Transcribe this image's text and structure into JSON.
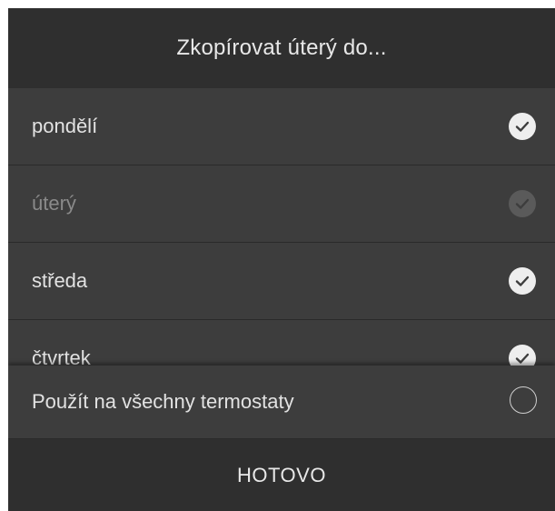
{
  "dialog": {
    "title": "Zkopírovat úterý do...",
    "days": [
      {
        "label": "pondělí",
        "checked": true,
        "disabled": false
      },
      {
        "label": "úterý",
        "checked": true,
        "disabled": true
      },
      {
        "label": "středa",
        "checked": true,
        "disabled": false
      },
      {
        "label": "čtvrtek",
        "checked": true,
        "disabled": false
      }
    ],
    "apply_all": {
      "label": "Použít na všechny termostaty",
      "checked": false
    },
    "done_label": "HOTOVO"
  },
  "colors": {
    "header_bg": "#2f2f2f",
    "row_bg": "#3d3d3d",
    "text": "#e2e2e2",
    "disabled_text": "#8a8a8a",
    "check_fill": "#eeeeee"
  }
}
